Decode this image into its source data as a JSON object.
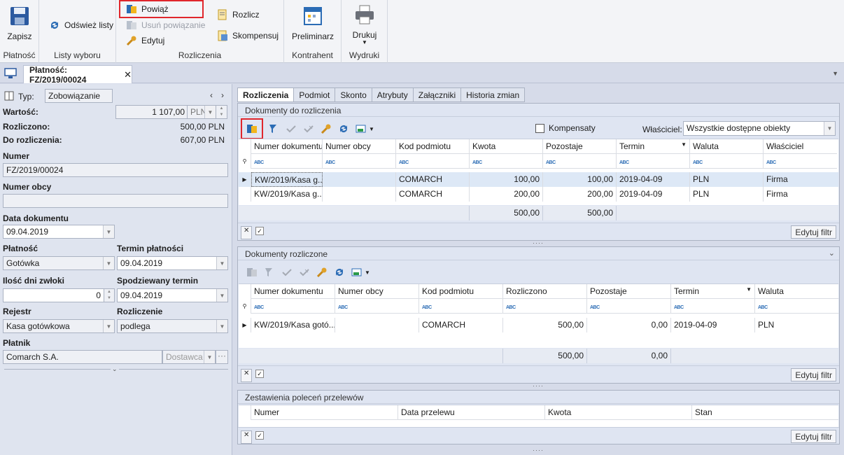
{
  "ribbon": {
    "save": "Zapisz",
    "group_platnosc": "Płatność",
    "refresh": "Odśwież listy",
    "group_listy": "Listy wyboru",
    "powiaz": "Powiąż",
    "usun": "Usuń powiązanie",
    "edytuj": "Edytuj",
    "rozlicz": "Rozlicz",
    "skompensuj": "Skompensuj",
    "group_rozliczenia": "Rozliczenia",
    "preliminarz": "Preliminarz",
    "group_kontrahent": "Kontrahent",
    "drukuj": "Drukuj",
    "group_wydruki": "Wydruki"
  },
  "doc_tab": {
    "title": "Płatność: FZ/2019/00024"
  },
  "left": {
    "typ_label": "Typ:",
    "typ_value": "Zobowiązanie",
    "wartosc_label": "Wartość:",
    "wartosc_value": "1 107,00",
    "wartosc_currency": "PLN",
    "rozliczono_label": "Rozliczono:",
    "rozliczono_value": "500,00 PLN",
    "do_rozliczenia_label": "Do rozliczenia:",
    "do_rozliczenia_value": "607,00 PLN",
    "numer_label": "Numer",
    "numer_value": "FZ/2019/00024",
    "numer_obcy_label": "Numer obcy",
    "numer_obcy_value": "",
    "data_dok_label": "Data dokumentu",
    "data_dok_value": "09.04.2019",
    "platnosc_label": "Płatność",
    "platnosc_value": "Gotówka",
    "termin_label": "Termin płatności",
    "termin_value": "09.04.2019",
    "dni_label": "Ilość dni zwłoki",
    "dni_value": "0",
    "spodz_label": "Spodziewany termin",
    "spodz_value": "09.04.2019",
    "rejestr_label": "Rejestr",
    "rejestr_value": "Kasa gotówkowa",
    "rozliczenie_label": "Rozliczenie",
    "rozliczenie_value": "podlega",
    "platnik_label": "Płatnik",
    "platnik_value": "Comarch S.A.",
    "platnik_type": "Dostawca"
  },
  "tabs": [
    "Rozliczenia",
    "Podmiot",
    "Skonto",
    "Atrybuty",
    "Załączniki",
    "Historia zmian"
  ],
  "panel1": {
    "title": "Dokumenty do rozliczenia",
    "kompensaty": "Kompensaty",
    "wlasciciel_label": "Właściciel:",
    "wlasciciel_value": "Wszystkie dostępne obiekty",
    "headers": [
      "Numer dokumentu",
      "Numer obcy",
      "Kod podmiotu",
      "Kwota",
      "Pozostaje",
      "Termin",
      "Waluta",
      "Właściciel"
    ],
    "rows": [
      [
        "KW/2019/Kasa g...",
        "",
        "COMARCH",
        "100,00",
        "100,00",
        "2019-04-09",
        "PLN",
        "Firma"
      ],
      [
        "KW/2019/Kasa g...",
        "",
        "COMARCH",
        "200,00",
        "200,00",
        "2019-04-09",
        "PLN",
        "Firma"
      ]
    ],
    "sum_kwota": "500,00",
    "sum_pozostaje": "500,00",
    "edit_filter": "Edytuj filtr"
  },
  "panel2": {
    "title": "Dokumenty rozliczone",
    "headers": [
      "Numer dokumentu",
      "Numer obcy",
      "Kod podmiotu",
      "Rozliczono",
      "Pozostaje",
      "Termin",
      "Waluta"
    ],
    "rows": [
      [
        "KW/2019/Kasa gotó...",
        "",
        "COMARCH",
        "500,00",
        "0,00",
        "2019-04-09",
        "PLN"
      ]
    ],
    "sum_rozliczono": "500,00",
    "sum_pozostaje": "0,00",
    "edit_filter": "Edytuj filtr"
  },
  "panel3": {
    "title": "Zestawienia poleceń przelewów",
    "headers": [
      "Numer",
      "Data przelewu",
      "Kwota",
      "Stan"
    ],
    "edit_filter": "Edytuj filtr"
  },
  "colors": {
    "accent": "#2b6cb5",
    "highlight": "#e0262c"
  }
}
